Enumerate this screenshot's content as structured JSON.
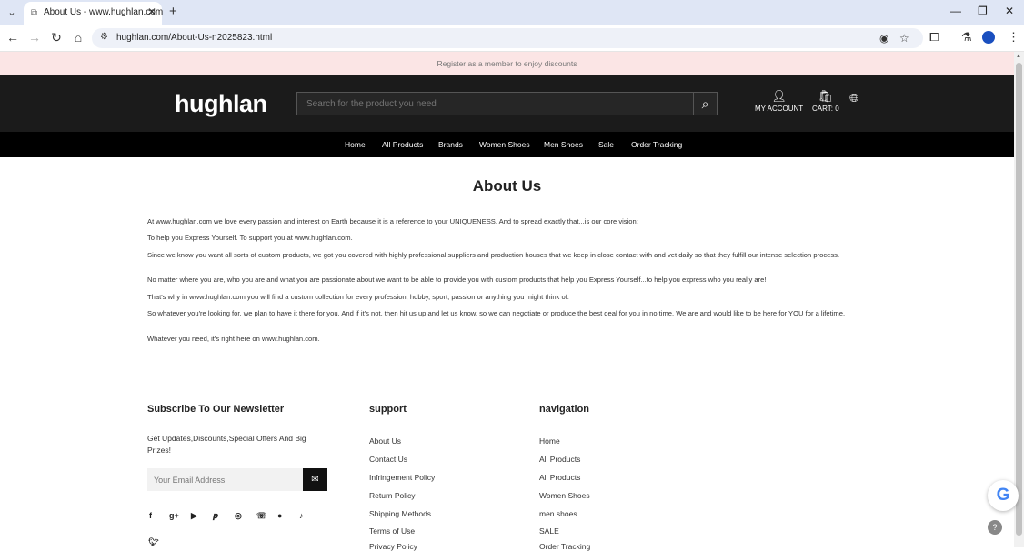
{
  "browser": {
    "tab_title": "About Us - www.hughlan.com",
    "url": "hughlan.com/About-Us-n2025823.html"
  },
  "promo": {
    "text": "Register as a member to enjoy discounts"
  },
  "header": {
    "logo": "hughlan",
    "search_placeholder": "Search for the product you need",
    "account_label": "MY ACCOUNT",
    "cart_label": "CART: 0"
  },
  "nav": {
    "items": [
      "Home",
      "All Products",
      "Brands",
      "Women Shoes",
      "Men Shoes",
      "Sale",
      "Order Tracking"
    ]
  },
  "content": {
    "title": "About Us",
    "paragraphs": [
      "At www.hughlan.com we love every passion and interest on Earth because it is a reference to your UNIQUENESS. And to spread exactly that...is our core vision:",
      "To help you Express Yourself. To support you at www.hughlan.com.",
      "Since we know you want all sorts of custom products, we got you covered with highly professional suppliers and production houses that we keep in close contact with and vet daily so that they fulfill our intense selection process.",
      "No matter where you are, who you are and what you are passionate about we want to be able to provide you with custom products that help you Express Yourself...to help you express who you really are!",
      "That's why in www.hughlan.com you will find a custom collection for every profession, hobby, sport, passion or anything you might think of.",
      "So whatever you're looking for, we plan to have it there for you. And if it's not, then hit us up and let us know, so we can negotiate or produce the best deal for you in no time. We are and would like to be here for YOU for a lifetime.",
      "Whatever you need, it's right here on www.hughlan.com."
    ]
  },
  "footer": {
    "newsletter": {
      "heading": "Subscribe To Our Newsletter",
      "text": "Get Updates,Discounts,Special Offers And Big Prizes!",
      "email_placeholder": "Your Email Address"
    },
    "support": {
      "heading": "support",
      "links": [
        "About Us",
        "Contact Us",
        "Infringement Policy",
        "Return Policy",
        "Shipping Methods",
        "Terms of Use",
        "Privacy Policy"
      ]
    },
    "navigation": {
      "heading": "navigation",
      "links": [
        "Home",
        "All Products",
        "All Products",
        "Women Shoes",
        "men shoes",
        "SALE",
        "Order Tracking"
      ]
    },
    "social_icons": [
      "facebook-icon",
      "google-plus-icon",
      "youtube-icon",
      "pinterest-icon",
      "instagram-icon",
      "whatsapp-icon",
      "line-icon",
      "tiktok-icon",
      "twitter-icon"
    ]
  }
}
